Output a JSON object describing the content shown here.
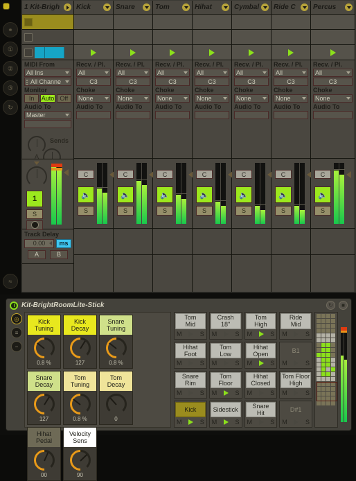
{
  "rail": {
    "icons": [
      {
        "name": "clip-view-icon",
        "glyph": ""
      },
      {
        "name": "plug-icon",
        "glyph": "⚭"
      },
      {
        "name": "circle-1-icon",
        "glyph": "①"
      },
      {
        "name": "circle-2-icon",
        "glyph": "②"
      },
      {
        "name": "circle-3-icon",
        "glyph": "③"
      },
      {
        "name": "refresh-icon",
        "glyph": "↻"
      },
      {
        "name": "wave-icon",
        "glyph": "≈"
      }
    ]
  },
  "session": {
    "tracks": [
      {
        "name": "1 Kit-Brigh",
        "button": "play",
        "midi_from_label": "MIDI From",
        "midi_from": "All Ins",
        "channel": "All Channe",
        "monitor_label": "Monitor",
        "monitor": [
          "In",
          "Auto",
          "Off"
        ],
        "monitor_active": "Auto",
        "audio_to_label": "Audio To",
        "audio_to": "Master",
        "extra": "",
        "sends_label": "Sends",
        "send_a": "A",
        "send_b": "B",
        "act": "1",
        "solo": "S",
        "meter": 96,
        "clip_top": true
      },
      {
        "name": "Kick",
        "button": "down",
        "recv_label": "Recv. / Pl.",
        "recv": "All",
        "note": "C3",
        "choke_label": "Choke",
        "choke": "None",
        "audio_to_label": "Audio To",
        "audio_to": "",
        "pan": "C",
        "solo": "S",
        "meter": 58
      },
      {
        "name": "Snare",
        "button": "down",
        "recv_label": "Recv. / Pl.",
        "recv": "All",
        "note": "C3",
        "choke_label": "Choke",
        "choke": "None",
        "audio_to_label": "Audio To",
        "audio_to": "",
        "pan": "C",
        "solo": "S",
        "meter": 70
      },
      {
        "name": "Tom",
        "button": "down",
        "recv_label": "Recv. / Pl.",
        "recv": "All",
        "note": "C3",
        "choke_label": "Choke",
        "choke": "None",
        "audio_to_label": "Audio To",
        "audio_to": "",
        "pan": "C",
        "solo": "S",
        "meter": 48
      },
      {
        "name": "Hihat",
        "button": "down",
        "recv_label": "Recv. / Pl.",
        "recv": "All",
        "note": "C3",
        "choke_label": "Choke",
        "choke": "None",
        "audio_to_label": "Audio To",
        "audio_to": "",
        "pan": "C",
        "solo": "S",
        "meter": 36
      },
      {
        "name": "Cymbal",
        "button": "down",
        "recv_label": "Recv. / Pl.",
        "recv": "All",
        "note": "C3",
        "choke_label": "Choke",
        "choke": "None",
        "audio_to_label": "Audio To",
        "audio_to": "",
        "pan": "C",
        "solo": "S",
        "meter": 30
      },
      {
        "name": "Ride C",
        "button": "down",
        "recv_label": "Recv. / Pl.",
        "recv": "All",
        "note": "C3",
        "choke_label": "Choke",
        "choke": "None",
        "audio_to_label": "Audio To",
        "audio_to": "",
        "pan": "C",
        "solo": "S",
        "meter": 30
      },
      {
        "name": "Percus",
        "button": "down",
        "recv_label": "Recv. / Pl.",
        "recv": "All",
        "note": "C3",
        "choke_label": "Choke",
        "choke": "None",
        "audio_to_label": "Audio To",
        "audio_to": "",
        "pan": "C",
        "solo": "S",
        "meter": 88
      }
    ],
    "track_delay": {
      "label": "Track Delay",
      "value": "0.00",
      "unit": "ms",
      "a": "A",
      "b": "B"
    }
  },
  "device": {
    "title": "Kit-BrightRoomLite-Stick",
    "header_icons": [
      {
        "name": "device-preset-icon",
        "glyph": "↻"
      },
      {
        "name": "device-save-icon",
        "glyph": "■"
      }
    ],
    "rail_icons": [
      {
        "name": "macro-view-icon",
        "glyph": "◎"
      },
      {
        "name": "chain-list-icon",
        "glyph": "≡"
      },
      {
        "name": "collapse-icon",
        "glyph": "−"
      }
    ],
    "macros": [
      {
        "label": "Kick Tuning",
        "value": "0.8 %",
        "angle": -52,
        "color": "#e8e81e",
        "arc": "#e89a1a"
      },
      {
        "label": "Kick Decay",
        "value": "127",
        "angle": 32,
        "color": "#e8e81e",
        "arc": "#e89a1a"
      },
      {
        "label": "Snare Tuning",
        "value": "0.8 %",
        "angle": -52,
        "color": "#cfe08a",
        "arc": "#e89a1a"
      },
      {
        "label": "Snare Decay",
        "value": "127",
        "angle": 32,
        "color": "#cfe08a",
        "arc": "#e89a1a"
      },
      {
        "label": "Tom Tuning",
        "value": "0.8 %",
        "angle": -52,
        "color": "#f0e49a",
        "arc": "#e89a1a"
      },
      {
        "label": "Tom Decay",
        "value": "0",
        "angle": -42,
        "color": "#f0e49a",
        "arc": "none"
      },
      {
        "label": "Hihat Pedal",
        "value": "00",
        "angle": 24,
        "color": "#6e6a56",
        "arc": "#e89a1a"
      },
      {
        "label": "Velocity Sens",
        "value": "90",
        "angle": 46,
        "color": "#ffffff",
        "arc": "#e89a1a"
      }
    ],
    "pad_controls": {
      "mute": "M",
      "solo": "S"
    },
    "pads": [
      [
        {
          "label": "Tom Mid",
          "play": false
        },
        {
          "label": "Crash 18\"",
          "play": false
        },
        {
          "label": "Tom High",
          "play": true
        },
        {
          "label": "Ride Mid",
          "play": false
        }
      ],
      [
        {
          "label": "Hihat Foot",
          "play": false
        },
        {
          "label": "Tom Low",
          "play": false
        },
        {
          "label": "Hihat Open",
          "play": true
        },
        {
          "label": "B1",
          "play": false,
          "vacant": true
        }
      ],
      [
        {
          "label": "Snare Rim",
          "play": false
        },
        {
          "label": "Tom Floor",
          "play": true
        },
        {
          "label": "Hihat Closed",
          "play": false
        },
        {
          "label": "Tom Floor High",
          "play": false
        }
      ],
      [
        {
          "label": "Kick",
          "play": true,
          "selected": true
        },
        {
          "label": "Sidestick",
          "play": true
        },
        {
          "label": "Snare Hit",
          "play": false
        },
        {
          "label": "D#1",
          "play": false,
          "vacant": true
        }
      ]
    ]
  }
}
